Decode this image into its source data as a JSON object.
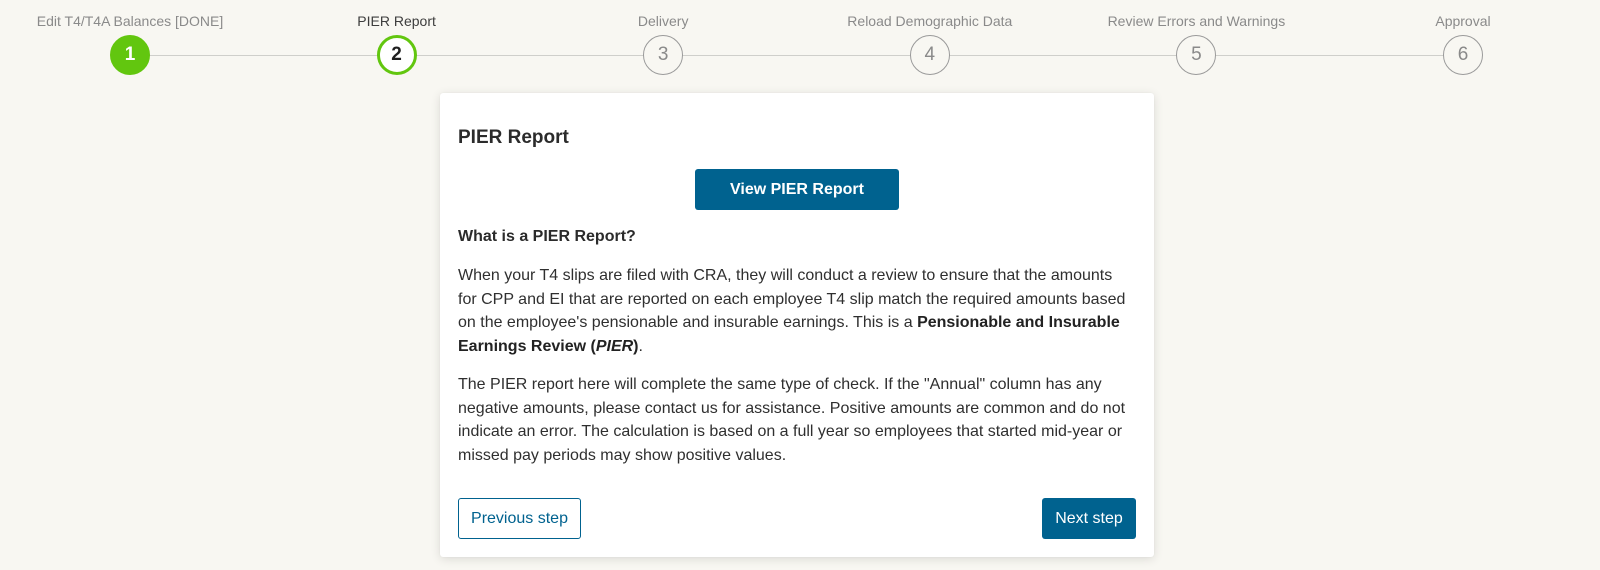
{
  "stepper": {
    "steps": [
      {
        "number": "1",
        "label": "Edit T4/T4A Balances [DONE]",
        "state": "done"
      },
      {
        "number": "2",
        "label": "PIER Report",
        "state": "current"
      },
      {
        "number": "3",
        "label": "Delivery",
        "state": "pending"
      },
      {
        "number": "4",
        "label": "Reload Demographic Data",
        "state": "pending"
      },
      {
        "number": "5",
        "label": "Review Errors and Warnings",
        "state": "pending"
      },
      {
        "number": "6",
        "label": "Approval",
        "state": "pending"
      }
    ]
  },
  "card": {
    "title": "PIER Report",
    "view_button": "View PIER Report",
    "question": "What is a PIER Report?",
    "para1_text": "When your T4 slips are filed with CRA, they will conduct a review to ensure that the amounts for CPP and EI that are reported on each employee T4 slip match the required amounts based on the employee's pensionable and insurable earnings. This is a ",
    "para1_bold": "Pensionable and Insurable Earnings Review (",
    "para1_italic": "PIER",
    "para1_end_bold": ")",
    "para1_period": ".",
    "para2": "The PIER report here will complete the same type of check. If the \"Annual\" column has any negative amounts, please contact us for assistance. Positive amounts are common and do not indicate an error. The calculation is based on a full year so employees that started mid-year or missed pay periods may show positive values.",
    "prev_button": "Previous step",
    "next_button": "Next step"
  },
  "colors": {
    "page_background": "#f8f7f2",
    "step_done": "#62c60f",
    "primary_button": "#00628f"
  }
}
